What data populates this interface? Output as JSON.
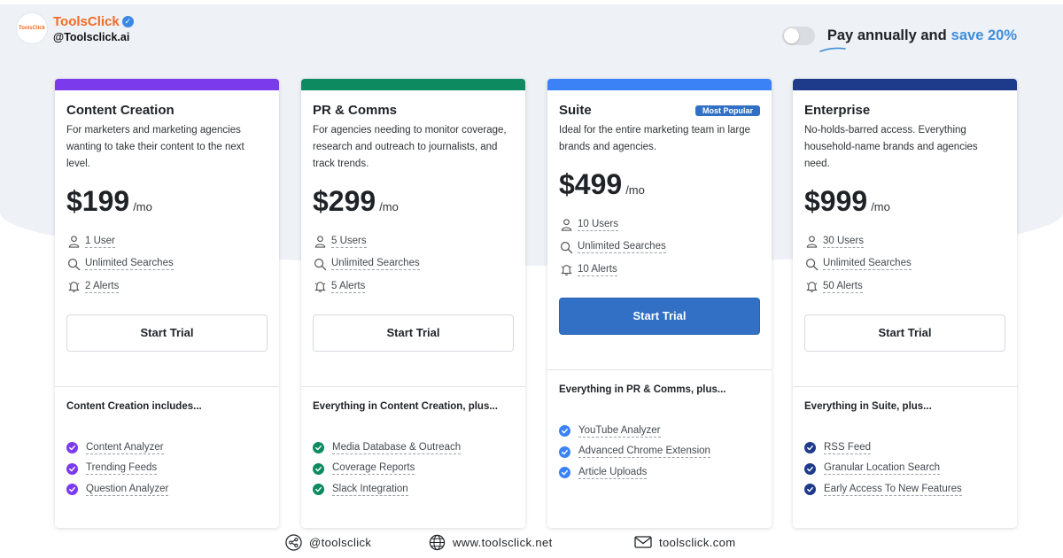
{
  "brand": {
    "logo_text": "ToolsClick",
    "name": "ToolsClick",
    "handle": "@Toolsclick.ai"
  },
  "billing": {
    "label": "Pay annually and",
    "save_text": "save 20%",
    "toggle_on": false
  },
  "plans": [
    {
      "title": "Content Creation",
      "accent": "#7c3aed",
      "description": "For marketers and marketing agencies wanting to take their content to the next level.",
      "price": "$199",
      "period": "/mo",
      "features": [
        "1 User",
        "Unlimited Searches",
        "2 Alerts"
      ],
      "cta": "Start Trial",
      "includes_title": "Content Creation includes...",
      "includes": [
        "Content Analyzer",
        "Trending Feeds",
        "Question Analyzer"
      ]
    },
    {
      "title": "PR & Comms",
      "accent": "#0d8a5f",
      "description": "For agencies needing to monitor coverage, research and outreach to journalists, and track trends.",
      "price": "$299",
      "period": "/mo",
      "features": [
        "5 Users",
        "Unlimited Searches",
        "5 Alerts"
      ],
      "cta": "Start Trial",
      "includes_title": "Everything in Content Creation, plus...",
      "includes": [
        "Media Database & Outreach",
        "Coverage Reports",
        "Slack Integration"
      ]
    },
    {
      "title": "Suite",
      "badge": "Most Popular",
      "accent": "#3b82f6",
      "description": "Ideal for the entire marketing team in large brands and agencies.",
      "price": "$499",
      "period": "/mo",
      "features": [
        "10 Users",
        "Unlimited Searches",
        "10 Alerts"
      ],
      "cta": "Start Trial",
      "includes_title": "Everything in PR & Comms, plus...",
      "includes": [
        "YouTube Analyzer",
        "Advanced Chrome Extension",
        "Article Uploads"
      ]
    },
    {
      "title": "Enterprise",
      "accent": "#1e3a8a",
      "description": "No-holds-barred access. Everything household-name brands and agencies need.",
      "price": "$999",
      "period": "/mo",
      "features": [
        "30 Users",
        "Unlimited Searches",
        "50 Alerts"
      ],
      "cta": "Start Trial",
      "includes_title": "Everything in Suite, plus...",
      "includes": [
        "RSS Feed",
        "Granular Location Search",
        "Early Access To New Features"
      ]
    }
  ],
  "footer": {
    "social": "@toolsclick",
    "website": "www.toolsclick.net",
    "email": "toolsclick.com"
  },
  "colors": {
    "brand_orange": "#f26b22",
    "primary_blue": "#3170c4",
    "save_blue": "#3e8ed9",
    "background": "#eef1f6"
  },
  "icons": {
    "user": "user-icon",
    "search": "search-icon",
    "alert": "bell-icon",
    "check": "check-circle-icon",
    "share": "share-icon",
    "globe": "globe-icon",
    "mail": "mail-icon"
  }
}
